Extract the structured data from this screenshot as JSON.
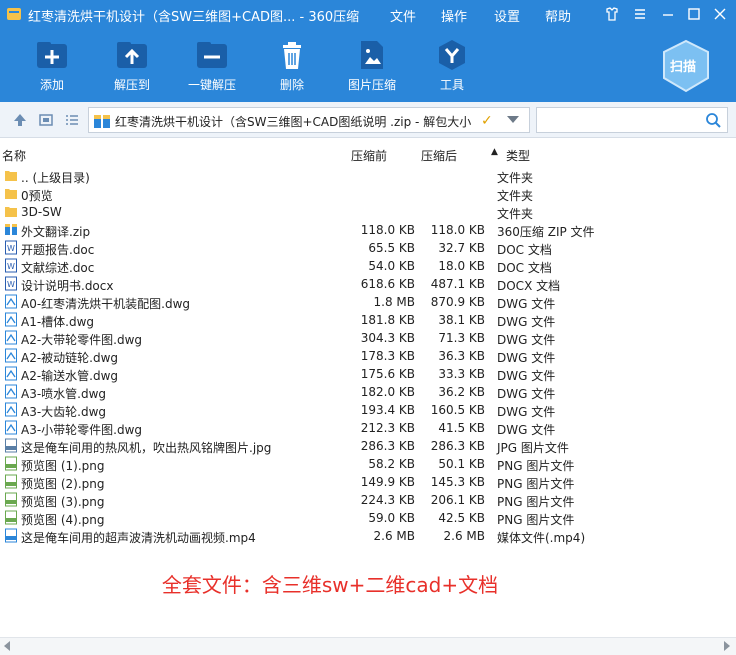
{
  "window": {
    "title": "红枣清洗烘干机设计（含SW三维图+CAD图... - 360压缩",
    "menu": [
      "文件",
      "操作",
      "设置",
      "帮助"
    ]
  },
  "toolbar": {
    "items": [
      {
        "label": "添加",
        "icon": "add-file-icon"
      },
      {
        "label": "解压到",
        "icon": "extract-to-icon"
      },
      {
        "label": "一键解压",
        "icon": "one-click-extract-icon"
      },
      {
        "label": "删除",
        "icon": "recycle-bin-icon"
      },
      {
        "label": "图片压缩",
        "icon": "image-compress-icon"
      },
      {
        "label": "工具",
        "icon": "tools-icon"
      }
    ],
    "scan_label": "扫描"
  },
  "address": {
    "path": "红枣清洗烘干机设计（含SW三维图+CAD图纸说明    .zip - 解包大小",
    "search_placeholder": ""
  },
  "columns": {
    "name": "名称",
    "compressed": "压缩前",
    "original": "压缩后",
    "type": "类型",
    "sort_arrow": "▲"
  },
  "files": [
    {
      "name": ".. (上级目录)",
      "compressed": "",
      "original": "",
      "type": "文件夹",
      "icon": "folder"
    },
    {
      "name": "0预览",
      "compressed": "",
      "original": "",
      "type": "文件夹",
      "icon": "folder"
    },
    {
      "name": "3D-SW",
      "compressed": "",
      "original": "",
      "type": "文件夹",
      "icon": "folder"
    },
    {
      "name": "外文翻译.zip",
      "compressed": "118.0 KB",
      "original": "118.0 KB",
      "type": "360压缩 ZIP 文件",
      "icon": "zip"
    },
    {
      "name": "开题报告.doc",
      "compressed": "65.5 KB",
      "original": "32.7 KB",
      "type": "DOC 文档",
      "icon": "doc"
    },
    {
      "name": "文献综述.doc",
      "compressed": "54.0 KB",
      "original": "18.0 KB",
      "type": "DOC 文档",
      "icon": "doc"
    },
    {
      "name": "设计说明书.docx",
      "compressed": "618.6 KB",
      "original": "487.1 KB",
      "type": "DOCX 文档",
      "icon": "doc"
    },
    {
      "name": "A0-红枣清洗烘干机装配图.dwg",
      "compressed": "1.8 MB",
      "original": "870.9 KB",
      "type": "DWG 文件",
      "icon": "dwg"
    },
    {
      "name": "A1-槽体.dwg",
      "compressed": "181.8 KB",
      "original": "38.1 KB",
      "type": "DWG 文件",
      "icon": "dwg"
    },
    {
      "name": "A2-大带轮零件图.dwg",
      "compressed": "304.3 KB",
      "original": "71.3 KB",
      "type": "DWG 文件",
      "icon": "dwg"
    },
    {
      "name": "A2-被动链轮.dwg",
      "compressed": "178.3 KB",
      "original": "36.3 KB",
      "type": "DWG 文件",
      "icon": "dwg"
    },
    {
      "name": "A2-输送水管.dwg",
      "compressed": "175.6 KB",
      "original": "33.3 KB",
      "type": "DWG 文件",
      "icon": "dwg"
    },
    {
      "name": "A3-喷水管.dwg",
      "compressed": "182.0 KB",
      "original": "36.2 KB",
      "type": "DWG 文件",
      "icon": "dwg"
    },
    {
      "name": "A3-大齿轮.dwg",
      "compressed": "193.4 KB",
      "original": "160.5 KB",
      "type": "DWG 文件",
      "icon": "dwg"
    },
    {
      "name": "A3-小带轮零件图.dwg",
      "compressed": "212.3 KB",
      "original": "41.5 KB",
      "type": "DWG 文件",
      "icon": "dwg"
    },
    {
      "name": "这是俺车间用的热风机，吹出热风铭牌图片.jpg",
      "compressed": "286.3 KB",
      "original": "286.3 KB",
      "type": "JPG 图片文件",
      "icon": "jpg"
    },
    {
      "name": "预览图 (1).png",
      "compressed": "58.2 KB",
      "original": "50.1 KB",
      "type": "PNG 图片文件",
      "icon": "png"
    },
    {
      "name": "预览图 (2).png",
      "compressed": "149.9 KB",
      "original": "145.3 KB",
      "type": "PNG 图片文件",
      "icon": "png"
    },
    {
      "name": "预览图 (3).png",
      "compressed": "224.3 KB",
      "original": "206.1 KB",
      "type": "PNG 图片文件",
      "icon": "png"
    },
    {
      "name": "预览图 (4).png",
      "compressed": "59.0 KB",
      "original": "42.5 KB",
      "type": "PNG 图片文件",
      "icon": "png"
    },
    {
      "name": "这是俺车间用的超声波清洗机动画视频.mp4",
      "compressed": "2.6 MB",
      "original": "2.6 MB",
      "type": "媒体文件(.mp4)",
      "icon": "mp4"
    }
  ],
  "promo_text": "全套文件：含三维sw+二维cad+文档",
  "colors": {
    "accent": "#2b86d9",
    "promo": "#e8302a",
    "folder": "#f5c24a"
  }
}
